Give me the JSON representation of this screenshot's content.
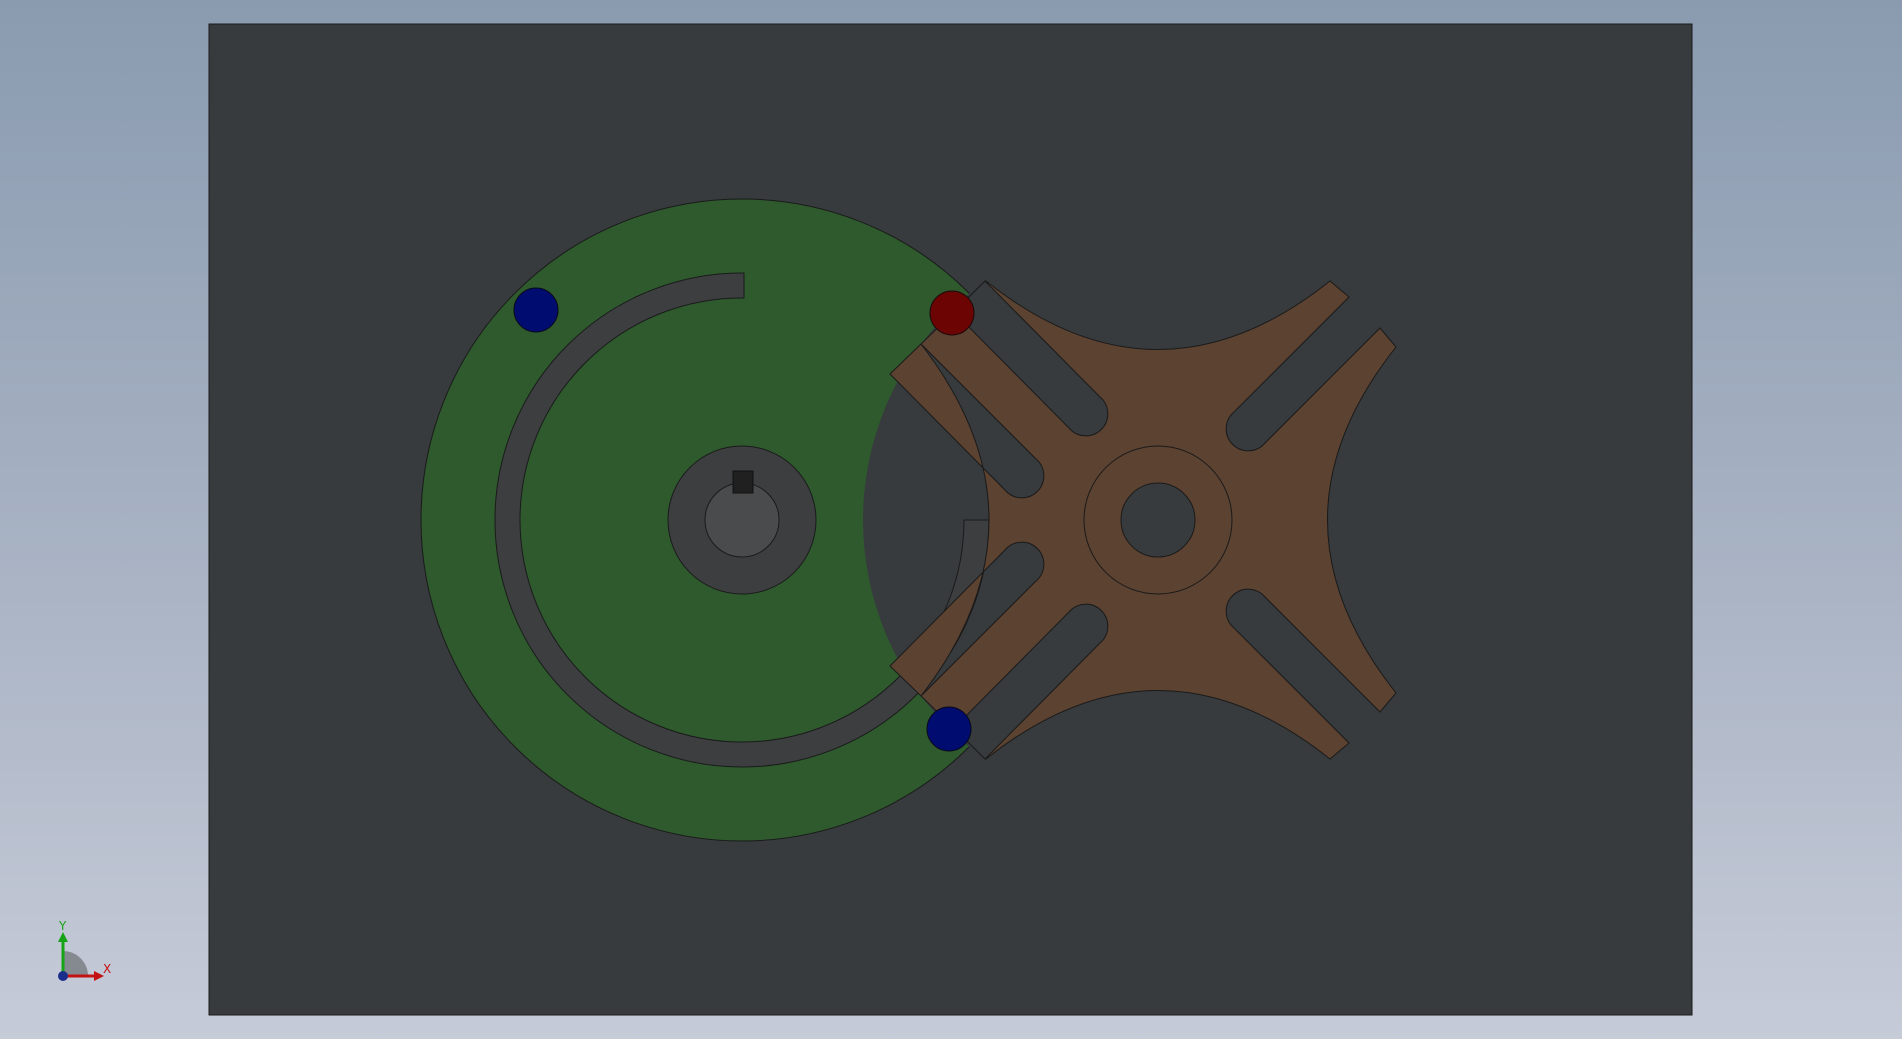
{
  "viewport": {
    "background": "gradient-blue-grey",
    "plate_color": "#373b3d",
    "edge_color": "#1a1a1a"
  },
  "model": {
    "drive_wheel": {
      "color": "#2e5a2d",
      "slot_color": "#3c3e40",
      "hub_color": "#3c3e40",
      "bore_color": "#4a4b4c",
      "key_color": "#202020"
    },
    "geneva_wheel": {
      "slots": 4,
      "color": "#5c4231",
      "bore_color": "#373b3d"
    },
    "markers": [
      {
        "name": "blue-marker-top",
        "color": "#000c70"
      },
      {
        "name": "red-marker-pin",
        "color": "#6d0404"
      },
      {
        "name": "blue-marker-bottom",
        "color": "#000c70"
      }
    ]
  },
  "triad": {
    "x_label": "X",
    "y_label": "Y",
    "x_color": "#c41212",
    "y_color": "#17a317",
    "z_color": "#1a2d8a"
  }
}
